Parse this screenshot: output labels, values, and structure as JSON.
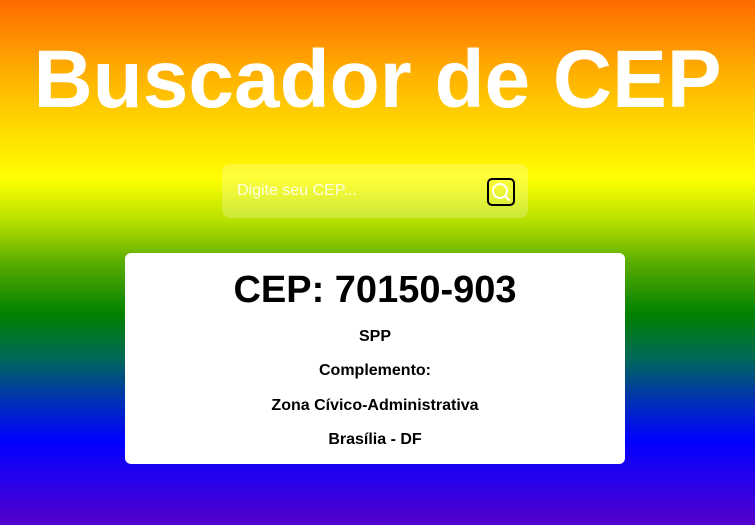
{
  "header": {
    "title": "Buscador de CEP"
  },
  "search": {
    "placeholder": "Digite seu CEP...",
    "value": "",
    "button_icon": "search-icon"
  },
  "result": {
    "cep_label": "CEP: 70150-903",
    "logradouro": "SPP",
    "complemento": "Complemento:",
    "bairro": "Zona Cívico-Administrativa",
    "cidade_uf": "Brasília - DF"
  },
  "colors": {
    "title": "#ffffff",
    "card_background": "#ffffff",
    "text": "#000000",
    "gradient": [
      "#ff6a00",
      "#ffff00",
      "#008000",
      "#0000ff",
      "#5500cc"
    ]
  }
}
